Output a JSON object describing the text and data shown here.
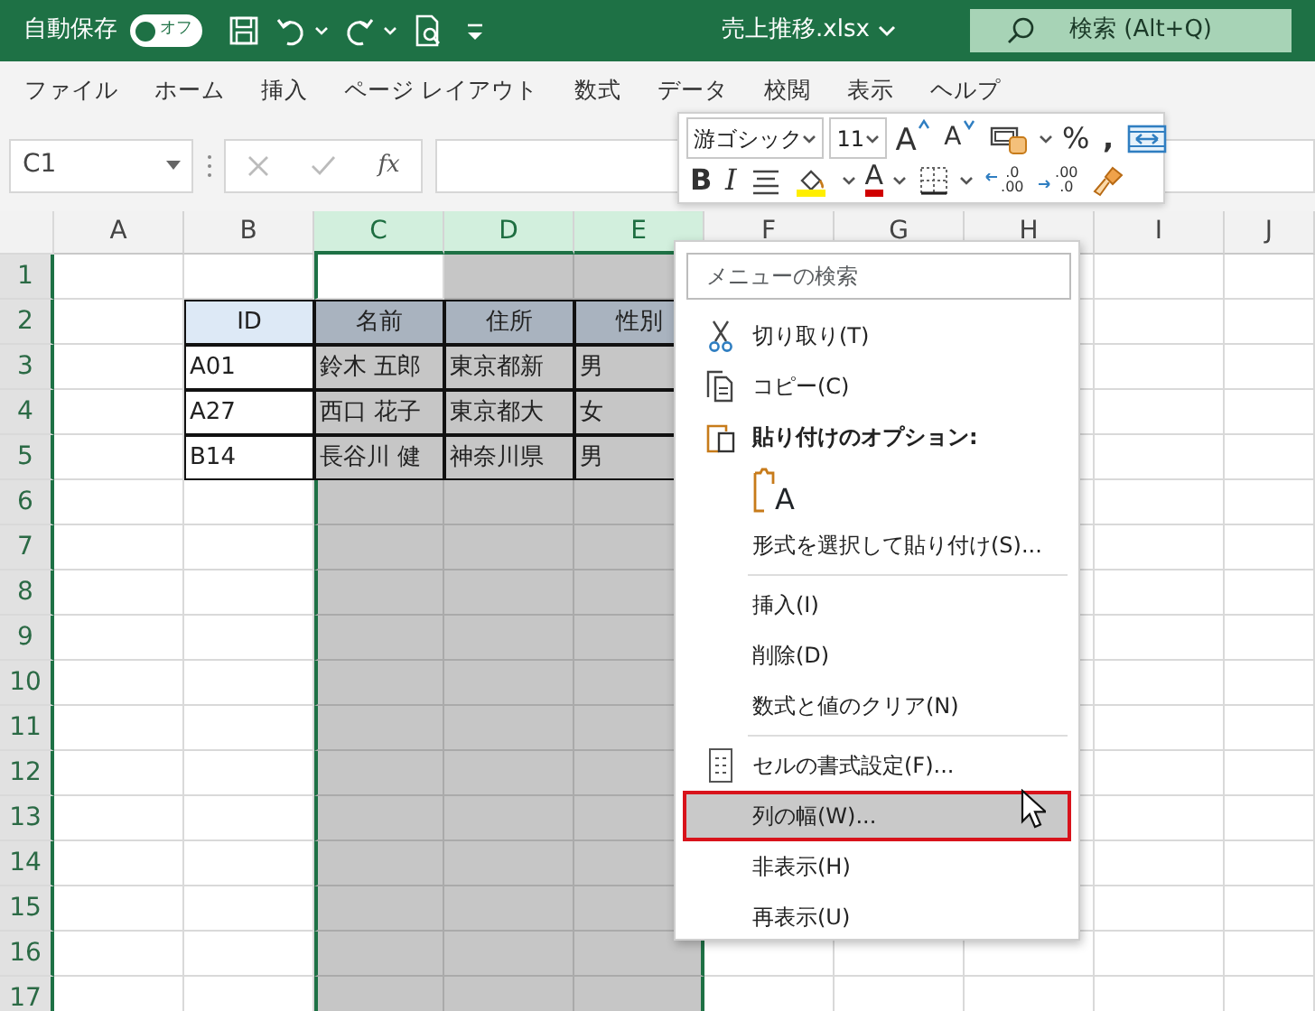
{
  "title_bar": {
    "autosave_label": "自動保存",
    "autosave": {
      "on": false,
      "label": "オフ"
    },
    "quick_access": [
      {
        "kind": "save"
      },
      {
        "kind": "undo",
        "split": true
      },
      {
        "kind": "redo",
        "split": true
      },
      {
        "kind": "print-preview"
      },
      {
        "kind": "customize"
      }
    ],
    "title": "売上推移.xlsx",
    "search": {
      "placeholder": "検索 (Alt+Q)"
    }
  },
  "menu_tabs": [
    "ファイル",
    "ホーム",
    "挿入",
    "ページ レイアウト",
    "数式",
    "データ",
    "校閲",
    "表示",
    "ヘルプ"
  ],
  "formula_bar": {
    "name_box": "C1",
    "function_label": "fx"
  },
  "columns": [
    {
      "label": "A",
      "selected": false
    },
    {
      "label": "B",
      "selected": false
    },
    {
      "label": "C",
      "selected": true
    },
    {
      "label": "D",
      "selected": true
    },
    {
      "label": "E",
      "selected": true
    },
    {
      "label": "F",
      "selected": false
    },
    {
      "label": "G",
      "selected": false
    },
    {
      "label": "H",
      "selected": false
    },
    {
      "label": "I",
      "selected": false
    },
    {
      "label": "J",
      "selected": false
    }
  ],
  "rows": [
    "1",
    "2",
    "3",
    "4",
    "5",
    "6",
    "7",
    "8",
    "9",
    "10",
    "11",
    "12",
    "13",
    "14",
    "15",
    "16",
    "17"
  ],
  "data_table": {
    "header": [
      "ID",
      "名前",
      "住所",
      "性別"
    ],
    "rows": [
      [
        "A01",
        "鈴木 五郎",
        "東京都新",
        "男"
      ],
      [
        "A27",
        "西口 花子",
        "東京都大",
        "女"
      ],
      [
        "B14",
        "長谷川 健",
        "神奈川県",
        "男"
      ]
    ]
  },
  "mini_toolbar": {
    "upper": {
      "items": [
        {
          "kind": "dropdown",
          "value": "游ゴシック"
        },
        {
          "kind": "dropdown",
          "value": "11"
        },
        {
          "kind": "grow",
          "text": "A"
        },
        {
          "kind": "shrink",
          "text": "A"
        },
        {
          "kind": "currency",
          "split": true
        },
        {
          "kind": "text",
          "text": "%"
        },
        {
          "kind": "text-bold",
          "text": ","
        },
        {
          "kind": "wrap"
        }
      ]
    },
    "lower": {
      "items": [
        {
          "kind": "text-bold",
          "text": "B"
        },
        {
          "kind": "text-italic",
          "text": "I"
        },
        {
          "kind": "align"
        },
        {
          "kind": "fill",
          "split": true
        },
        {
          "kind": "font-color",
          "text": "A",
          "split": true
        },
        {
          "kind": "borders",
          "split": true
        },
        {
          "kind": "decimal-increase",
          "top": ".0",
          "bottom": ".00"
        },
        {
          "kind": "decimal-decrease",
          "top": ".00",
          "bottom": ".0"
        },
        {
          "kind": "painter"
        }
      ]
    }
  },
  "context_menu": {
    "search": {
      "placeholder": "メニューの検索"
    },
    "items": [
      {
        "kind": "cut",
        "label": "切り取り(T)",
        "selected": false
      },
      {
        "kind": "copy",
        "label": "コピー(C)",
        "selected": false
      },
      {
        "kind": "heading",
        "label": "貼り付けのオプション:"
      },
      {
        "kind": "paste-option",
        "text": "A"
      },
      {
        "kind": "item",
        "label": "形式を選択して貼り付け(S)...",
        "selected": false
      },
      {
        "kind": "divider"
      },
      {
        "kind": "item",
        "label": "挿入(I)",
        "selected": false
      },
      {
        "kind": "item",
        "label": "削除(D)",
        "selected": false
      },
      {
        "kind": "item",
        "label": "数式と値のクリア(N)",
        "selected": false
      },
      {
        "kind": "divider"
      },
      {
        "kind": "format",
        "label": "セルの書式設定(F)...",
        "selected": false
      },
      {
        "kind": "item",
        "label": "列の幅(W)...",
        "selected": true
      },
      {
        "kind": "item",
        "label": "非表示(H)",
        "selected": false
      },
      {
        "kind": "item",
        "label": "再表示(U)",
        "selected": false
      }
    ]
  }
}
